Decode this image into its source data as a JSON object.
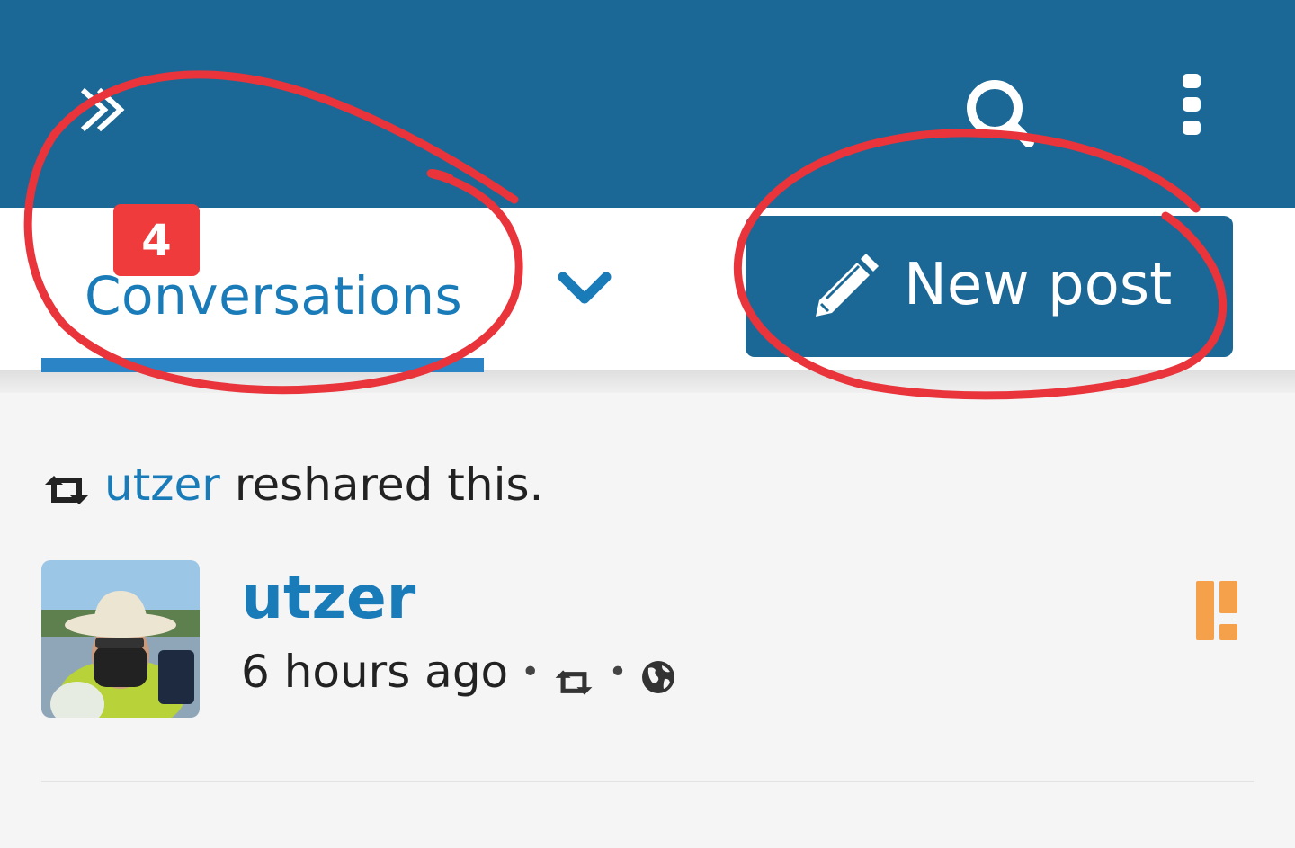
{
  "topbar": {
    "background": "#1b6896",
    "icons": [
      "double-chevron-right-icon",
      "search-icon",
      "vertical-ellipsis-icon"
    ]
  },
  "tabs": {
    "active_label": "Conversations",
    "badge_count": "4",
    "dropdown_icon": "chevron-down-icon"
  },
  "new_post": {
    "label": "New post",
    "icon": "pencil-icon"
  },
  "post": {
    "reshare_icon": "reshare-icon",
    "resharer": "utzer",
    "reshare_text": "reshared this.",
    "author": "utzer",
    "time": "6 hours ago",
    "separator": "•",
    "visibility_icon": "globe-icon",
    "network_icon": "diaspora-network-icon"
  },
  "colors": {
    "accent": "#1a7bb9",
    "badge": "#ef3b3b",
    "annotation": "#e8343a",
    "network_icon": "#f5a04a"
  }
}
